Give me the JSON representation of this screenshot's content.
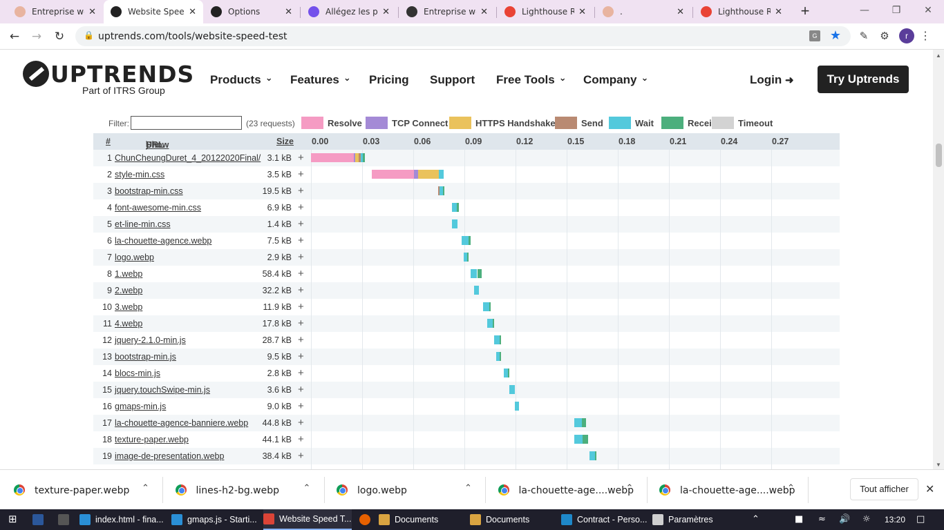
{
  "browser": {
    "tabs": [
      {
        "label": "Entreprise web",
        "icon": "owl-icon",
        "color": "#e8b4a0",
        "active": false
      },
      {
        "label": "Website Speed",
        "icon": "uptrends-icon",
        "color": "#222222",
        "active": true
      },
      {
        "label": "Options",
        "icon": "github-icon",
        "color": "#222222",
        "active": false
      },
      {
        "label": "Allégez les pag",
        "icon": "openclassrooms-icon",
        "color": "#7451eb",
        "active": false
      },
      {
        "label": "Entreprise web",
        "icon": "globe-icon",
        "color": "#333333",
        "active": false
      },
      {
        "label": "Lighthouse Rep",
        "icon": "lighthouse-icon",
        "color": "#e94335",
        "active": false
      },
      {
        "label": ".",
        "icon": "owl-icon",
        "color": "#e8b4a0",
        "active": false
      },
      {
        "label": "Lighthouse Rep",
        "icon": "lighthouse-icon",
        "color": "#e94335",
        "active": false
      }
    ],
    "url": "uptrends.com/tools/website-speed-test",
    "profile_initial": "r"
  },
  "site": {
    "logo_text": "UPTRENDS",
    "logo_sub": "Part of ITRS Group",
    "nav": [
      {
        "label": "Products",
        "has_caret": true
      },
      {
        "label": "Features",
        "has_caret": true
      },
      {
        "label": "Pricing",
        "has_caret": false
      },
      {
        "label": "Support",
        "has_caret": false
      },
      {
        "label": "Free Tools",
        "has_caret": true
      },
      {
        "label": "Company",
        "has_caret": true
      }
    ],
    "login": "Login",
    "try_button": "Try Uptrends"
  },
  "waterfall": {
    "filter_label": "Filter:",
    "filter_value": "",
    "request_count": "(23 requests)",
    "legend": [
      {
        "label": "Resolve",
        "color": "#f59bc3"
      },
      {
        "label": "TCP Connect",
        "color": "#a48ad6"
      },
      {
        "label": "HTTPS Handshake",
        "color": "#eac25c"
      },
      {
        "label": "Send",
        "color": "#b98a72"
      },
      {
        "label": "Wait",
        "color": "#53c9dc"
      },
      {
        "label": "Receive",
        "color": "#4caf7d"
      },
      {
        "label": "Timeout",
        "color": "#d3d3d3"
      }
    ],
    "header": {
      "num": "#",
      "url_prefix": "URL (",
      "show_domains": "Show domains",
      "url_suffix": ")",
      "size": "Size"
    },
    "axis_ticks": [
      "0.00",
      "0.03",
      "0.06",
      "0.09",
      "0.12",
      "0.15",
      "0.18",
      "0.21",
      "0.24",
      "0.27"
    ],
    "rows": [
      {
        "n": "1",
        "url": "ChunCheungDuret_4_20122020Final/",
        "size": "3.1 kB",
        "resolve": [
          0.0,
          0.025
        ],
        "tcp": [
          0.025,
          0.026
        ],
        "https": [
          0.026,
          0.028
        ],
        "send": [
          0.028,
          0.029
        ],
        "wait": [
          0.029,
          0.0305
        ],
        "receive": [
          0.0305,
          0.0315
        ]
      },
      {
        "n": "2",
        "url": "style-min.css",
        "size": "3.5 kB",
        "resolve": [
          0.0355,
          0.0605
        ],
        "tcp": [
          0.0605,
          0.063
        ],
        "https": [
          0.063,
          0.075
        ],
        "wait": [
          0.075,
          0.078
        ]
      },
      {
        "n": "3",
        "url": "bootstrap-min.css",
        "size": "19.5 kB",
        "send": [
          0.0745,
          0.0755
        ],
        "wait": [
          0.0755,
          0.0775
        ],
        "receive": [
          0.0775,
          0.078
        ]
      },
      {
        "n": "4",
        "url": "font-awesome-min.css",
        "size": "6.9 kB",
        "wait": [
          0.0825,
          0.0855
        ],
        "receive": [
          0.0855,
          0.0868
        ]
      },
      {
        "n": "5",
        "url": "et-line-min.css",
        "size": "1.4 kB",
        "wait": [
          0.0825,
          0.0858
        ]
      },
      {
        "n": "6",
        "url": "la-chouette-agence.webp",
        "size": "7.5 kB",
        "wait": [
          0.0885,
          0.0925
        ],
        "receive": [
          0.0925,
          0.0935
        ]
      },
      {
        "n": "7",
        "url": "logo.webp",
        "size": "2.9 kB",
        "wait": [
          0.0895,
          0.0915
        ],
        "receive": [
          0.0915,
          0.092
        ]
      },
      {
        "n": "8",
        "url": "1.webp",
        "size": "58.4 kB",
        "wait": [
          0.0935,
          0.0975
        ],
        "receive": [
          0.0975,
          0.1
        ]
      },
      {
        "n": "9",
        "url": "2.webp",
        "size": "32.2 kB",
        "wait": [
          0.0955,
          0.0985
        ]
      },
      {
        "n": "10",
        "url": "3.webp",
        "size": "11.9 kB",
        "wait": [
          0.101,
          0.1045
        ],
        "receive": [
          0.1045,
          0.105
        ]
      },
      {
        "n": "11",
        "url": "4.webp",
        "size": "17.8 kB",
        "wait": [
          0.1035,
          0.1065
        ],
        "receive": [
          0.1065,
          0.1075
        ]
      },
      {
        "n": "12",
        "url": "jquery-2.1.0-min.js",
        "size": "28.7 kB",
        "wait": [
          0.1075,
          0.1105
        ],
        "receive": [
          0.1105,
          0.1115
        ]
      },
      {
        "n": "13",
        "url": "bootstrap-min.js",
        "size": "9.5 kB",
        "wait": [
          0.1085,
          0.1105
        ],
        "receive": [
          0.1105,
          0.1115
        ]
      },
      {
        "n": "14",
        "url": "blocs-min.js",
        "size": "2.8 kB",
        "wait": [
          0.113,
          0.1155
        ],
        "receive": [
          0.1155,
          0.1165
        ]
      },
      {
        "n": "15",
        "url": "jquery.touchSwipe-min.js",
        "size": "3.6 kB",
        "wait": [
          0.1165,
          0.1195
        ]
      },
      {
        "n": "16",
        "url": "gmaps-min.js",
        "size": "9.0 kB",
        "wait": [
          0.1195,
          0.122
        ]
      },
      {
        "n": "17",
        "url": "la-chouette-agence-banniere.webp",
        "size": "44.8 kB",
        "wait": [
          0.1545,
          0.159
        ],
        "receive": [
          0.159,
          0.1615
        ]
      },
      {
        "n": "18",
        "url": "texture-paper.webp",
        "size": "44.1 kB",
        "wait": [
          0.1545,
          0.1595
        ],
        "receive": [
          0.1595,
          0.1625
        ]
      },
      {
        "n": "19",
        "url": "image-de-presentation.webp",
        "size": "38.4 kB",
        "wait": [
          0.1635,
          0.1665
        ],
        "receive": [
          0.1665,
          0.1675
        ]
      }
    ]
  },
  "downloads": {
    "items": [
      "texture-paper.webp",
      "lines-h2-bg.webp",
      "logo.webp",
      "la-chouette-age....webp",
      "la-chouette-age....webp"
    ],
    "show_all": "Tout afficher"
  },
  "taskbar": {
    "items": [
      {
        "label": "index.html - fina...",
        "color": "#2a8fd6"
      },
      {
        "label": "gmaps.js - Starti...",
        "color": "#2a8fd6"
      },
      {
        "label": "Website Speed T...",
        "color": "#db4437"
      },
      {
        "label": "Documents",
        "color": "#d9a441"
      },
      {
        "label": "Documents",
        "color": "#d9a441"
      },
      {
        "label": "Contract - Perso...",
        "color": "#1e88c9"
      },
      {
        "label": "Paramètres",
        "color": "#cfcfcf"
      }
    ],
    "time": "13:20"
  }
}
